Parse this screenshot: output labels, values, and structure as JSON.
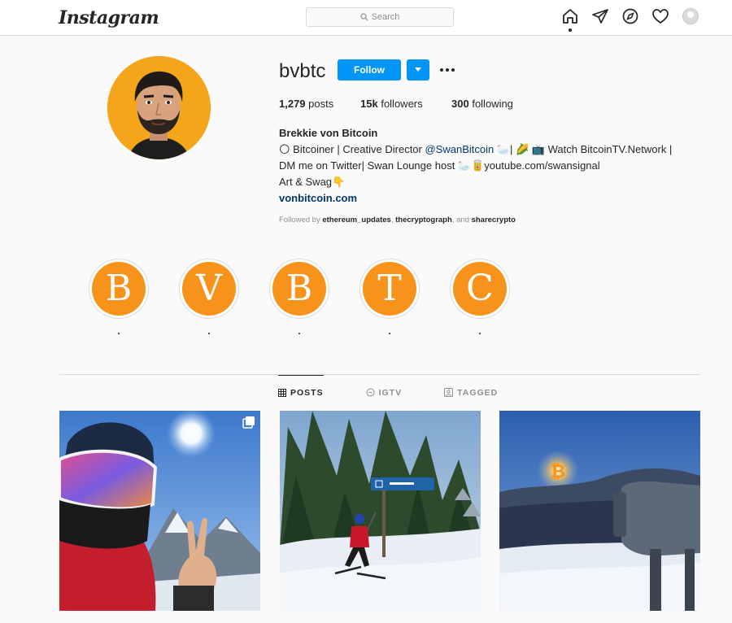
{
  "nav": {
    "logo": "Instagram",
    "search_placeholder": "Search",
    "icons": [
      "home-icon",
      "direct-icon",
      "explore-icon",
      "activity-heart-icon",
      "profile-avatar"
    ]
  },
  "profile": {
    "username": "bvbtc",
    "follow_label": "Follow",
    "stats": {
      "posts_count": "1,279",
      "posts_label": "posts",
      "followers_count": "15k",
      "followers_label": "followers",
      "following_count": "300",
      "following_label": "following"
    },
    "full_name": "Brekkie von Bitcoin",
    "bio_line1_a": "🌕 Bitcoiner | Creative Director ",
    "bio_mention": "@SwanBitcoin",
    "bio_line1_b": " 🦢| 🌽 📺 Watch BitcoinTV.Network |",
    "bio_line2": "DM me on Twitter| Swan Lounge host 🦢🥫youtube.com/swansignal",
    "bio_line3": "Art & Swag👇",
    "website": "vonbitcoin.com",
    "followed_by_prefix": "Followed by ",
    "followed_by_1": "ethereum_updates",
    "followed_by_sep": ", ",
    "followed_by_2": "thecryptograph",
    "followed_by_and": ", and ",
    "followed_by_3": "sharecrypto"
  },
  "highlights": [
    {
      "letter": "B",
      "label": "."
    },
    {
      "letter": "V",
      "label": "."
    },
    {
      "letter": "B",
      "label": "."
    },
    {
      "letter": "T",
      "label": "."
    },
    {
      "letter": "C",
      "label": "."
    }
  ],
  "tabs": [
    {
      "label": "POSTS",
      "active": true
    },
    {
      "label": "IGTV",
      "active": false
    },
    {
      "label": "TAGGED",
      "active": false
    }
  ],
  "colors": {
    "accent_blue": "#0095f6",
    "bitcoin_orange": "#f7931a",
    "link": "#00376b"
  }
}
